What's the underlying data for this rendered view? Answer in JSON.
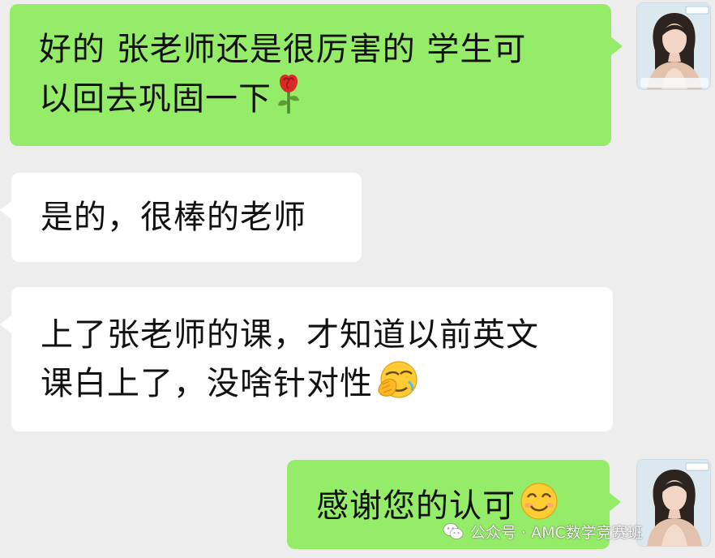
{
  "messages": [
    {
      "side": "right",
      "lines": [
        "好的 张老师还是很厉害的 学生可",
        "以回去巩固一下"
      ],
      "emoji": "rose-emoji"
    },
    {
      "side": "left",
      "lines": [
        "是的，很棒的老师"
      ]
    },
    {
      "side": "left",
      "lines": [
        "上了张老师的课，才知道以前英文",
        "课白上了，没啥针对性"
      ],
      "emoji": "facepalm-emoji"
    },
    {
      "side": "right",
      "lines": [
        "感谢您的认可"
      ],
      "emoji": "smiling-face-emoji"
    }
  ],
  "watermark": {
    "text": "公众号 · AMC数学竞赛班",
    "icon": "wechat-official-account-icon"
  },
  "colors": {
    "background": "#ededed",
    "outgoing_bubble": "#95ec69",
    "incoming_bubble": "#ffffff"
  }
}
